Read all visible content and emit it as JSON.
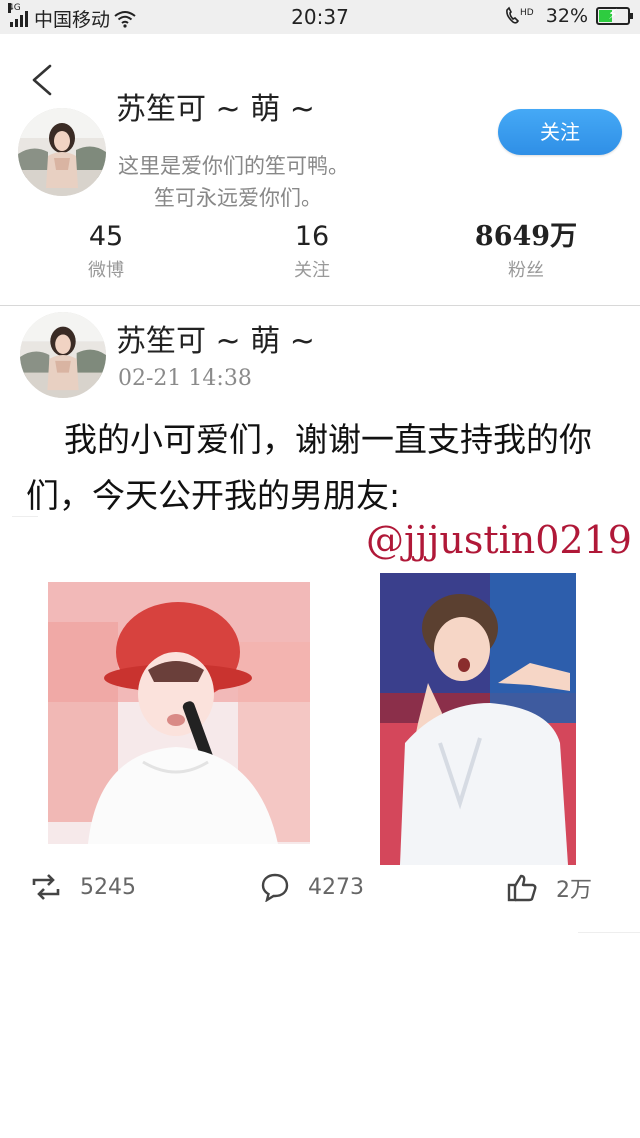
{
  "status_bar": {
    "network_tag": "4G",
    "carrier": "中国移动",
    "time": "20:37",
    "hd_tag": "HD",
    "battery": "32%",
    "battery_level": 0.32,
    "battery_color": "#2ecc40"
  },
  "profile": {
    "name": "苏笙可 ~ 萌 ~",
    "bio_line1": "这里是爱你们的笙可鸭。",
    "bio_line2": "笙可永远爱你们。",
    "follow_button": "关注",
    "stats": [
      {
        "value": "45",
        "label": "微博"
      },
      {
        "value": "16",
        "label": "关注"
      },
      {
        "value": "8649万",
        "label": "粉丝"
      }
    ]
  },
  "post": {
    "author": "苏笙可 ~ 萌 ~",
    "timestamp": "02-21  14:38",
    "text": "我的小可爱们，谢谢一直支持我的你们，今天公开我的男朋友:",
    "mention": "@jjjustin0219",
    "mention_color": "#b01838",
    "actions": {
      "repost_count": "5245",
      "comment_count": "4273",
      "like_count": "2万"
    }
  },
  "icons": {
    "back": "chevron-left-icon",
    "repost": "repost-icon",
    "comment": "comment-icon",
    "like": "thumbs-up-icon"
  },
  "accent_color": "#2f8fe6"
}
